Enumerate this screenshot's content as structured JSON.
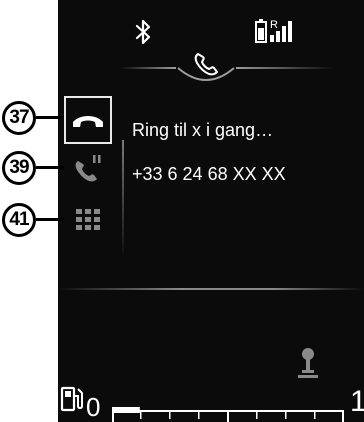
{
  "status_bar": {
    "bluetooth_icon": "bluetooth-icon",
    "battery_signal_icon": "battery-signal-icon",
    "roaming_label": "R"
  },
  "header": {
    "icon": "phone-icon"
  },
  "menu": [
    {
      "id": "hangup",
      "icon": "hangup-icon",
      "callout": "37",
      "selected": true
    },
    {
      "id": "hold",
      "icon": "hold-call-icon",
      "callout": "39",
      "selected": false
    },
    {
      "id": "keypad",
      "icon": "keypad-icon",
      "callout": "41",
      "selected": false
    }
  ],
  "call": {
    "status": "Ring til x i gang…",
    "number": "+33 6 24 68 XX XX"
  },
  "footer": {
    "gear_icon": "gear-shift-icon",
    "fuel_icon": "fuel-pump-icon",
    "fuel_min": "0",
    "fuel_max": "1",
    "fuel_level": 0.12
  },
  "callouts": {
    "c37": "37",
    "c39": "39",
    "c41": "41"
  },
  "colors": {
    "screen_bg": "#0b0b0b",
    "text": "#ffffff",
    "icon": "#ffffff",
    "dim": "#9c9c9c"
  }
}
